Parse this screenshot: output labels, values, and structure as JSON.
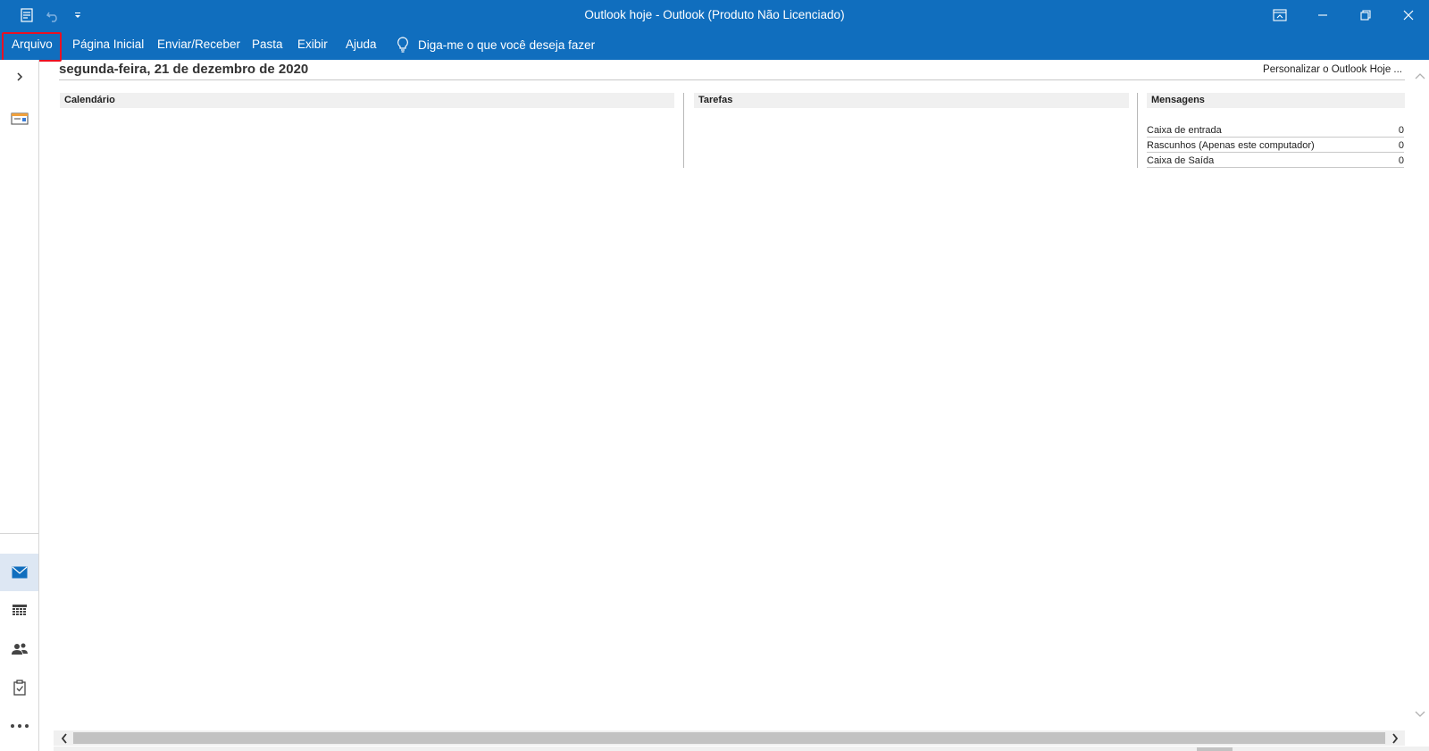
{
  "window": {
    "title": "Outlook hoje  -  Outlook (Produto Não Licenciado)"
  },
  "quick_access": {
    "icons": [
      "send-receive-icon",
      "undo-icon",
      "customize-qat-icon"
    ]
  },
  "window_controls": {
    "icons": [
      "ribbon-display-options-icon",
      "minimize-icon",
      "restore-icon",
      "close-icon"
    ]
  },
  "ribbon": {
    "tabs": [
      {
        "label": "Arquivo"
      },
      {
        "label": "Página Inicial"
      },
      {
        "label": "Enviar/Receber"
      },
      {
        "label": "Pasta"
      },
      {
        "label": "Exibir"
      },
      {
        "label": "Ajuda"
      }
    ],
    "tell_me": "Diga-me o que você deseja fazer",
    "highlighted_tab": "Arquivo",
    "accent_color": "#106ebe",
    "highlight_color": "#e81123"
  },
  "left_nav": {
    "icons": [
      "expand-chevron-icon",
      "outlook-today-icon",
      "mail-icon",
      "calendar-icon",
      "people-icon",
      "tasks-icon",
      "more-icon"
    ],
    "active": "mail-icon"
  },
  "today": {
    "date": "segunda-feira, 21 de dezembro de 2020",
    "customize_link": "Personalizar o Outlook Hoje ...",
    "columns": {
      "calendar": "Calendário",
      "tasks": "Tarefas",
      "messages": "Mensagens"
    },
    "messages": [
      {
        "label": "Caixa de entrada",
        "count": "0"
      },
      {
        "label": "Rascunhos (Apenas este computador)",
        "count": "0"
      },
      {
        "label": "Caixa de Saída",
        "count": "0"
      }
    ]
  }
}
